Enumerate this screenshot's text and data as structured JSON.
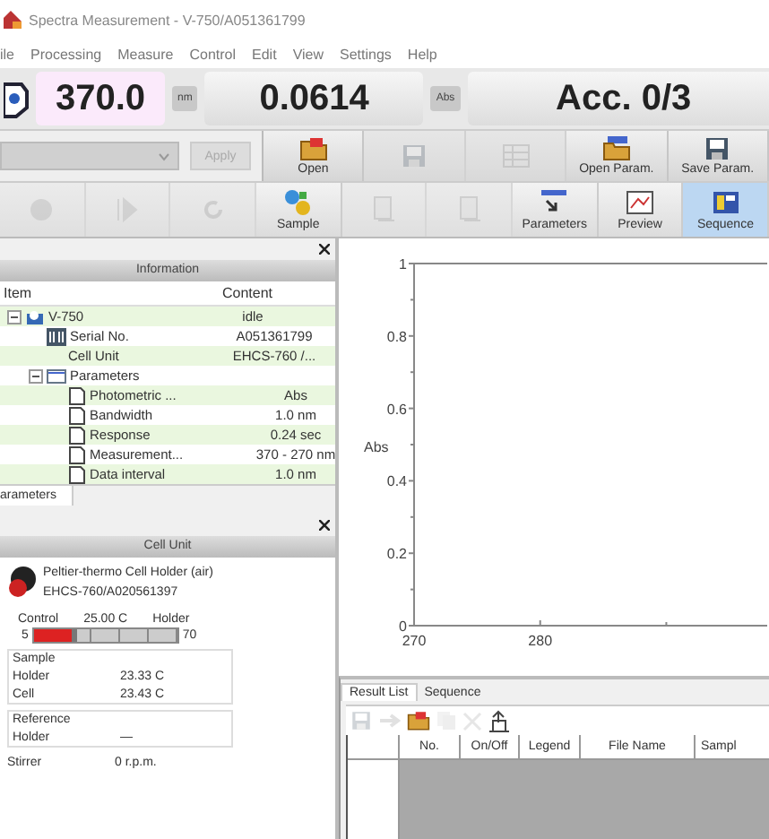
{
  "window": {
    "title": "Spectra Measurement - V-750/A051361799"
  },
  "menu": [
    "ile",
    "Processing",
    "Measure",
    "Control",
    "Edit",
    "View",
    "Settings",
    "Help"
  ],
  "readouts": {
    "wavelength": "370.0",
    "wavelength_unit": "nm",
    "value": "0.0614",
    "value_unit": "Abs",
    "accumulation": "Acc. 0/3"
  },
  "toolbar_top": {
    "dropdown": {
      "disabled": true
    },
    "apply": {
      "label": "Apply",
      "disabled": true
    },
    "buttons": [
      {
        "kind": "open",
        "label": "Open",
        "disabled": false
      },
      {
        "kind": "save",
        "disabled": true
      },
      {
        "kind": "grid",
        "disabled": true
      },
      {
        "kind": "open-param",
        "label": "Open Param.",
        "disabled": false
      },
      {
        "kind": "save-param",
        "label": "Save Param.",
        "disabled": false
      }
    ]
  },
  "toolbar_bottom": [
    {
      "kind": "circle",
      "disabled": true,
      "selected": false
    },
    {
      "kind": "play",
      "disabled": true,
      "selected": false
    },
    {
      "kind": "refresh",
      "disabled": true,
      "selected": false
    },
    {
      "kind": "sample",
      "label": "Sample",
      "disabled": false,
      "selected": false
    },
    {
      "kind": "doc",
      "disabled": true,
      "selected": false
    },
    {
      "kind": "doc",
      "disabled": true,
      "selected": false
    },
    {
      "kind": "parameters",
      "label": "Parameters",
      "disabled": false,
      "selected": false
    },
    {
      "kind": "preview",
      "label": "Preview",
      "disabled": false,
      "selected": false
    },
    {
      "kind": "sequence",
      "label": "Sequence",
      "disabled": false,
      "selected": true
    }
  ],
  "information": {
    "title": "Information",
    "columns": [
      "Item",
      "Content"
    ],
    "tree": [
      {
        "kind": "device",
        "name": "V-750",
        "content": "idle",
        "expanded": true,
        "children": [
          {
            "kind": "serial",
            "name": "Serial No.",
            "content": "A051361799"
          },
          {
            "kind": "none",
            "name": "Cell Unit",
            "content": "EHCS-760 /..."
          },
          {
            "kind": "folder",
            "name": "Parameters",
            "expanded": true,
            "children": [
              {
                "kind": "page",
                "name": "Photometric ...",
                "content": "Abs"
              },
              {
                "kind": "page",
                "name": "Bandwidth",
                "content": "1.0 nm"
              },
              {
                "kind": "page",
                "name": "Response",
                "content": "0.24 sec"
              },
              {
                "kind": "page",
                "name": "Measurement...",
                "content": "370 - 270 nm"
              },
              {
                "kind": "page",
                "name": "Data interval",
                "content": "1.0 nm"
              }
            ]
          }
        ]
      }
    ],
    "tabs": [
      {
        "label": "arameters",
        "selected": true
      }
    ]
  },
  "cell_unit": {
    "title": "Cell Unit",
    "holder_name": "Peltier-thermo Cell Holder (air)",
    "holder_id": "EHCS-760/A020561397",
    "control_label": "Control",
    "control_value": "25.00 C",
    "control_target": "Holder",
    "slider_min": "5",
    "slider_max": "70",
    "level": 0.3,
    "sample": {
      "title": "Sample",
      "rows": [
        {
          "label": "Holder",
          "value": "23.33 C"
        },
        {
          "label": "Cell",
          "value": "23.43 C"
        }
      ]
    },
    "reference": {
      "title": "Reference",
      "rows": [
        {
          "label": "Holder",
          "value": "—"
        }
      ]
    },
    "stirrer": {
      "label": "Stirrer",
      "value": "0 r.p.m."
    }
  },
  "chart": {
    "chart_data": {
      "type": "line",
      "ylabel": "Abs",
      "xlim": [
        270,
        298
      ],
      "ylim": [
        0,
        1
      ],
      "xticks": [
        270,
        280
      ],
      "yticks": [
        0,
        0.2,
        0.4,
        0.6,
        0.8,
        {
          "value": 1,
          "label": "1"
        }
      ]
    }
  },
  "results": {
    "tabs": [
      {
        "label": "Result List",
        "selected": true
      },
      {
        "label": "Sequence",
        "selected": false
      }
    ],
    "tools": [
      {
        "kind": "save",
        "disabled": true
      },
      {
        "kind": "arrow",
        "disabled": true
      },
      {
        "kind": "open",
        "disabled": false
      },
      {
        "kind": "copy",
        "disabled": true
      },
      {
        "kind": "delete",
        "disabled": true
      },
      {
        "kind": "export",
        "disabled": false
      }
    ],
    "columns": [
      "No.",
      "On/Off",
      "Legend",
      "File Name",
      "Sampl"
    ]
  }
}
